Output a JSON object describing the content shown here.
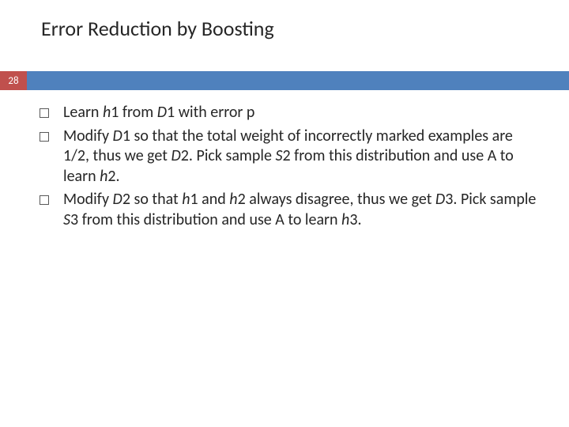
{
  "title": "Error Reduction by Boosting",
  "badge": "28",
  "bullets": [
    {
      "parts": [
        {
          "t": "Learn ",
          "i": false
        },
        {
          "t": "h",
          "i": true
        },
        {
          "t": "1 from ",
          "i": false
        },
        {
          "t": "D",
          "i": true
        },
        {
          "t": "1 with error p",
          "i": false
        }
      ]
    },
    {
      "parts": [
        {
          "t": "Modify ",
          "i": false
        },
        {
          "t": "D",
          "i": true
        },
        {
          "t": "1 so that the total weight of incorrectly marked examples are 1/2, thus we get ",
          "i": false
        },
        {
          "t": "D",
          "i": true
        },
        {
          "t": "2. Pick sample ",
          "i": false
        },
        {
          "t": "S",
          "i": true
        },
        {
          "t": "2 from this distribution and use A to learn ",
          "i": false
        },
        {
          "t": "h",
          "i": true
        },
        {
          "t": "2.",
          "i": false
        }
      ]
    },
    {
      "parts": [
        {
          "t": "Modify ",
          "i": false
        },
        {
          "t": "D",
          "i": true
        },
        {
          "t": "2 so that ",
          "i": false
        },
        {
          "t": "h",
          "i": true
        },
        {
          "t": "1 and ",
          "i": false
        },
        {
          "t": "h",
          "i": true
        },
        {
          "t": "2 always disagree, thus we get ",
          "i": false
        },
        {
          "t": "D",
          "i": true
        },
        {
          "t": "3. Pick sample ",
          "i": false
        },
        {
          "t": "S",
          "i": true
        },
        {
          "t": "3 from this distribution and use A to learn ",
          "i": false
        },
        {
          "t": "h",
          "i": true
        },
        {
          "t": "3.",
          "i": false
        }
      ]
    }
  ]
}
